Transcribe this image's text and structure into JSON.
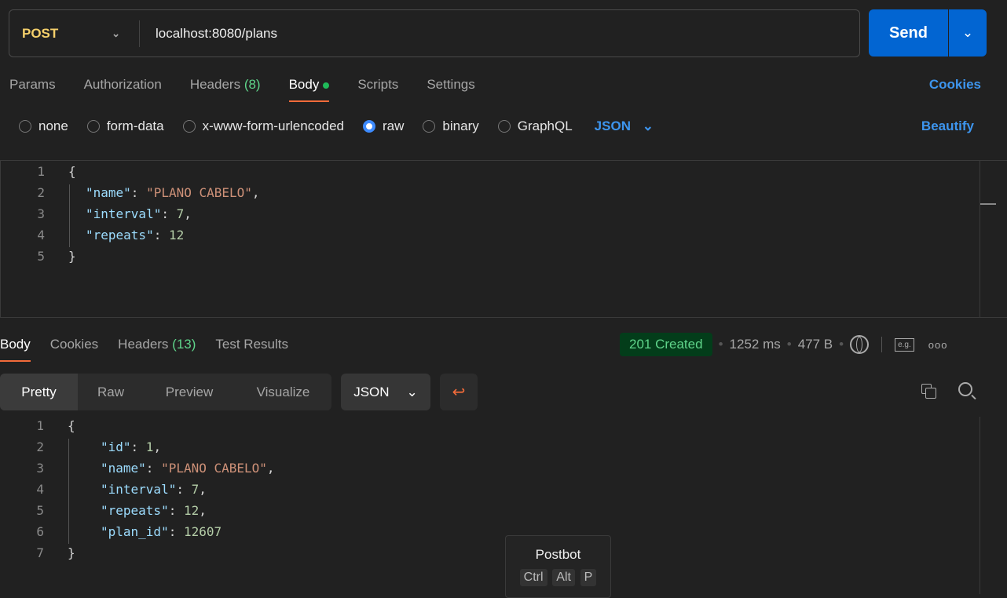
{
  "request": {
    "method": "POST",
    "url": "localhost:8080/plans",
    "send_label": "Send"
  },
  "request_tabs": [
    {
      "label": "Params"
    },
    {
      "label": "Authorization"
    },
    {
      "label": "Headers",
      "count": "(8)"
    },
    {
      "label": "Body"
    },
    {
      "label": "Scripts"
    },
    {
      "label": "Settings"
    }
  ],
  "cookies_label": "Cookies",
  "body_types": [
    {
      "label": "none",
      "selected": false
    },
    {
      "label": "form-data",
      "selected": false
    },
    {
      "label": "x-www-form-urlencoded",
      "selected": false
    },
    {
      "label": "raw",
      "selected": true
    },
    {
      "label": "binary",
      "selected": false
    },
    {
      "label": "GraphQL",
      "selected": false
    }
  ],
  "body_format": "JSON",
  "beautify_label": "Beautify",
  "request_body_lines": [
    "1",
    "2",
    "3",
    "4",
    "5"
  ],
  "request_body": {
    "name_key": "\"name\"",
    "name_val": "\"PLANO CABELO\"",
    "interval_key": "\"interval\"",
    "interval_val": "7",
    "repeats_key": "\"repeats\"",
    "repeats_val": "12"
  },
  "response_tabs": [
    {
      "label": "Body"
    },
    {
      "label": "Cookies"
    },
    {
      "label": "Headers",
      "count": "(13)"
    },
    {
      "label": "Test Results"
    }
  ],
  "response_status": {
    "status": "201 Created",
    "time": "1252 ms",
    "size": "477 B",
    "status_color": "#5fd48a"
  },
  "view_modes": [
    "Pretty",
    "Raw",
    "Preview",
    "Visualize"
  ],
  "response_format": "JSON",
  "response_body": {
    "id_key": "\"id\"",
    "id_val": "1",
    "name_key": "\"name\"",
    "name_val": "\"PLANO CABELO\"",
    "interval_key": "\"interval\"",
    "interval_val": "7",
    "repeats_key": "\"repeats\"",
    "repeats_val": "12",
    "plan_id_key": "\"plan_id\"",
    "plan_id_val": "12607"
  },
  "response_body_lines": [
    "1",
    "2",
    "3",
    "4",
    "5",
    "6",
    "7"
  ],
  "postbot": {
    "title": "Postbot",
    "keys": [
      "Ctrl",
      "Alt",
      "P"
    ]
  },
  "colors": {
    "accent": "#0265d2",
    "tab_underline": "#f26b3a",
    "json_key": "#9cdcfe",
    "json_string": "#ce9178",
    "json_number": "#b5cea8"
  }
}
